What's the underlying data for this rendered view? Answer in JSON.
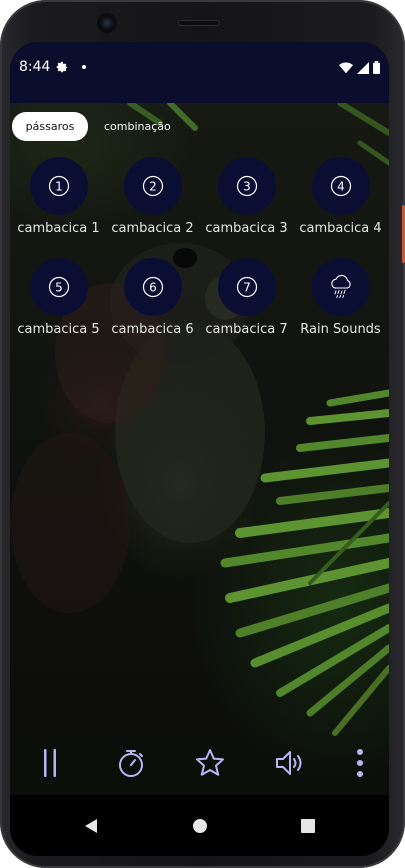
{
  "status_bar": {
    "time": "8:44",
    "icons": [
      "gear-icon",
      "notification-dot",
      "wifi-icon",
      "signal-icon",
      "battery-icon"
    ]
  },
  "tabs": [
    {
      "label": "pássaros",
      "active": true
    },
    {
      "label": "combinação",
      "active": false
    }
  ],
  "sounds": [
    {
      "glyph": "①",
      "label": "cambacica 1"
    },
    {
      "glyph": "②",
      "label": "cambacica 2"
    },
    {
      "glyph": "③",
      "label": "cambacica 3"
    },
    {
      "glyph": "④",
      "label": "cambacica 4"
    },
    {
      "glyph": "⑤",
      "label": "cambacica 5"
    },
    {
      "glyph": "⑥",
      "label": "cambacica 6"
    },
    {
      "glyph": "⑦",
      "label": "cambacica 7"
    },
    {
      "glyph": "rain-cloud-icon",
      "label": "Rain Sounds"
    }
  ],
  "bottom_bar": {
    "buttons": [
      "pause-icon",
      "timer-icon",
      "star-icon",
      "volume-icon",
      "more-vert-icon"
    ]
  },
  "nav_bar": {
    "buttons": [
      "back-icon",
      "home-icon",
      "recents-icon"
    ]
  },
  "colors": {
    "status_bar": "#0b0d2c",
    "sound_circle": "#0b0e33",
    "accent_icon": "#b9b5f5"
  }
}
